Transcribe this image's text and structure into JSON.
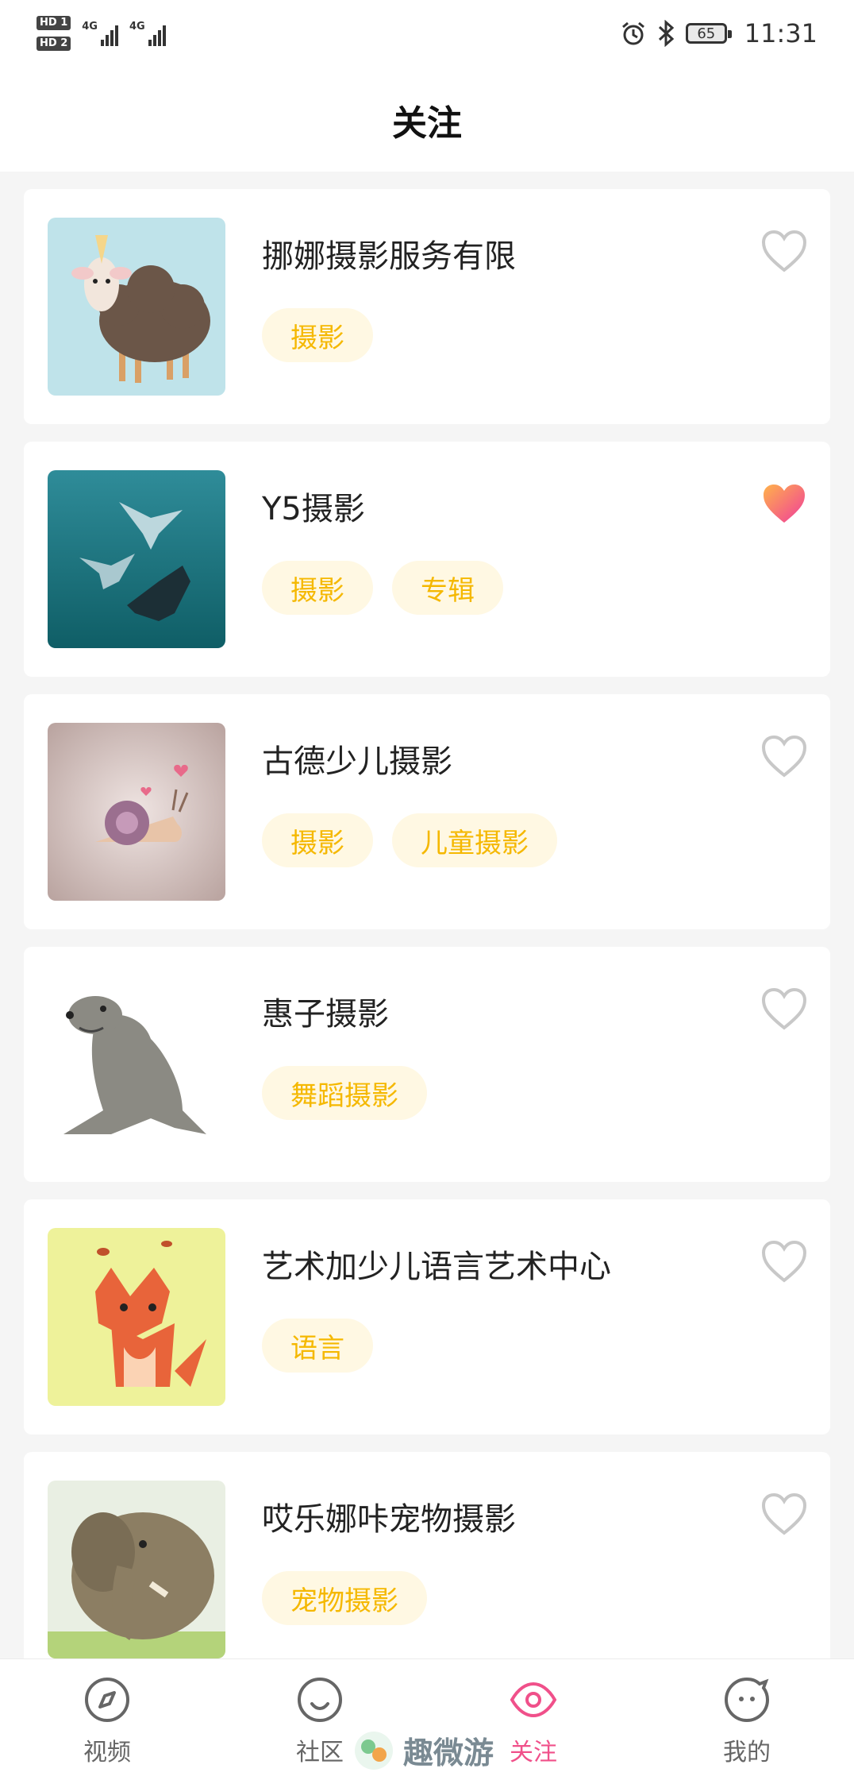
{
  "status": {
    "time": "11:31",
    "battery": "65",
    "sim1": "HD 1",
    "sim2": "HD 2",
    "net1": "4G",
    "net2": "4G"
  },
  "header": {
    "title": "关注"
  },
  "items": [
    {
      "name": "挪娜摄影服务有限",
      "tags": [
        "摄影"
      ],
      "liked": false,
      "thumb": "sheep-unicorn"
    },
    {
      "name": "Y5摄影",
      "tags": [
        "摄影",
        "专辑"
      ],
      "liked": true,
      "thumb": "manta-rays"
    },
    {
      "name": "古德少儿摄影",
      "tags": [
        "摄影",
        "儿童摄影"
      ],
      "liked": false,
      "thumb": "snail"
    },
    {
      "name": "惠子摄影",
      "tags": [
        "舞蹈摄影"
      ],
      "liked": false,
      "thumb": "sea-lion"
    },
    {
      "name": "艺术加少儿语言艺术中心",
      "tags": [
        "语言"
      ],
      "liked": false,
      "thumb": "fox"
    },
    {
      "name": "哎乐娜咔宠物摄影",
      "tags": [
        "宠物摄影"
      ],
      "liked": false,
      "thumb": "elephant"
    }
  ],
  "tabs": [
    {
      "label": "视频",
      "icon": "compass-icon",
      "active": false
    },
    {
      "label": "社区",
      "icon": "smile-icon",
      "active": false
    },
    {
      "label": "关注",
      "icon": "eye-icon",
      "active": true
    },
    {
      "label": "我的",
      "icon": "face-icon",
      "active": false
    }
  ],
  "watermark": "趣微游",
  "colors": {
    "accent": "#f0508a",
    "tag_text": "#f5b800",
    "tag_bg": "#fff8e3"
  }
}
